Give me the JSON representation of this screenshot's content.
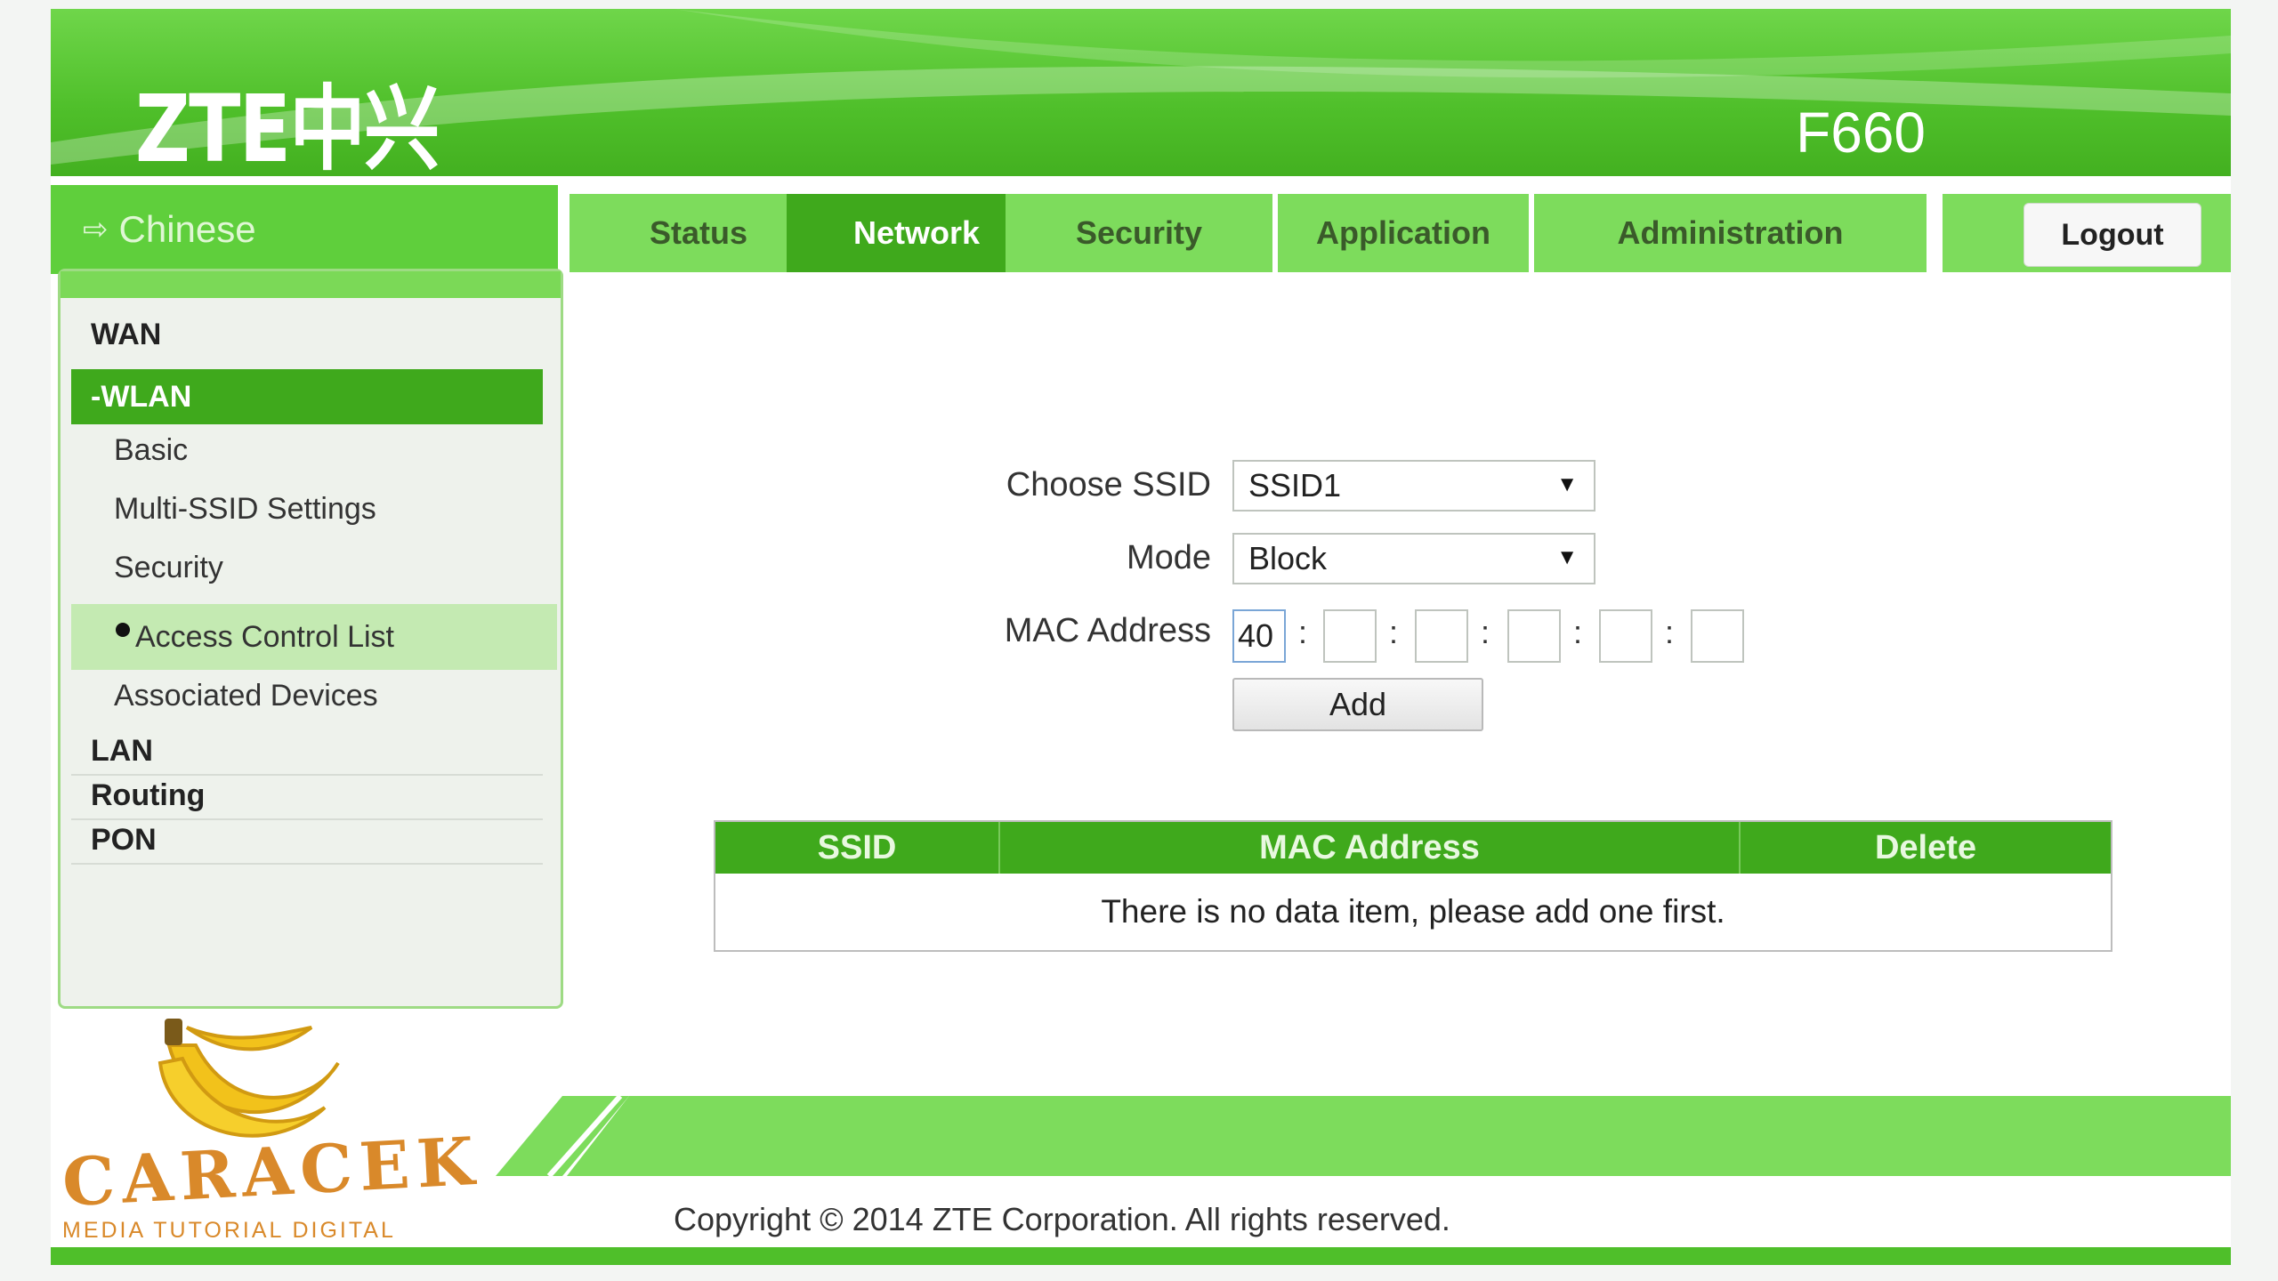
{
  "header": {
    "logo": "ZTE中兴",
    "model": "F660"
  },
  "nav": {
    "language": "Chinese",
    "tabs": [
      "Status",
      "Network",
      "Security",
      "Application",
      "Administration"
    ],
    "active_tab": "Network",
    "logout": "Logout"
  },
  "sidebar": {
    "wan": "WAN",
    "wlan": "-WLAN",
    "wlan_items": [
      "Basic",
      "Multi-SSID Settings",
      "Security",
      "Access Control List",
      "Associated Devices"
    ],
    "lan": "LAN",
    "routing": "Routing",
    "pon": "PON"
  },
  "form": {
    "ssid_label": "Choose SSID",
    "ssid_value": "SSID1",
    "mode_label": "Mode",
    "mode_value": "Block",
    "mac_label": "MAC Address",
    "mac_values": [
      "40",
      "",
      "",
      "",
      "",
      ""
    ],
    "mac_separator": ":",
    "add_button": "Add"
  },
  "table": {
    "headers": [
      "SSID",
      "MAC Address",
      "Delete"
    ],
    "empty_message": "There is no data item, please add one first."
  },
  "footer": {
    "copyright": "Copyright © 2014 ZTE Corporation. All rights reserved."
  },
  "watermark": {
    "title": "CARACEK",
    "subtitle": "MEDIA TUTORIAL DIGITAL"
  },
  "colors": {
    "brand_green": "#4fbf2a",
    "active_green": "#3fa91c",
    "tab_green": "#7ddc5c",
    "watermark": "#d9892a"
  }
}
